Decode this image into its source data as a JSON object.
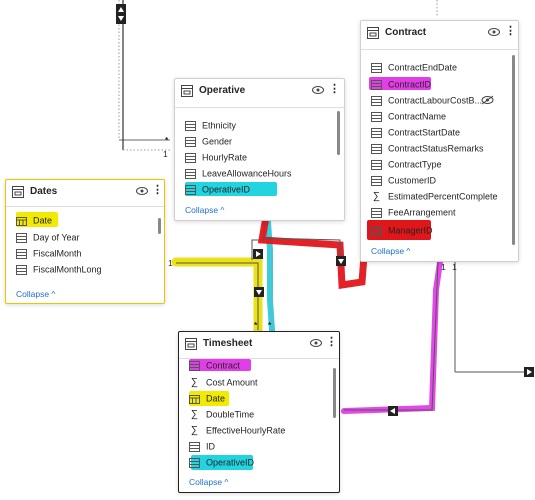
{
  "operative": {
    "title": "Operative",
    "fields": [
      "Ethnicity",
      "Gender",
      "HourlyRate",
      "LeaveAllowanceHours",
      "OperativeID"
    ],
    "collapse": "Collapse ^"
  },
  "contract": {
    "title": "Contract",
    "fields": [
      "ContractEndDate",
      "ContractID",
      "ContractLabourCostB...",
      "ContractName",
      "ContractStartDate",
      "ContractStatusRemarks",
      "ContractType",
      "CustomerID",
      "EstimatedPercentComplete",
      "FeeArrangement",
      "ManagerID"
    ],
    "collapse": "Collapse ^"
  },
  "dates": {
    "title": "Dates",
    "fields": [
      "Date",
      "Day of Year",
      "FiscalMonth",
      "FiscalMonthLong"
    ],
    "collapse": "Collapse ^"
  },
  "timesheet": {
    "title": "Timesheet",
    "fields": [
      "Contract",
      "Cost Amount",
      "Date",
      "DoubleTime",
      "EffectiveHourlyRate",
      "ID",
      "OperativeID"
    ],
    "collapse": "Collapse ^"
  },
  "relationships": {
    "one_label": "1",
    "many_label": "*"
  },
  "highlight_colors": {
    "yellow": "#f2ea00",
    "cyan": "#22d3e0",
    "magenta": "#e23ee8",
    "red": "#e0161b"
  }
}
